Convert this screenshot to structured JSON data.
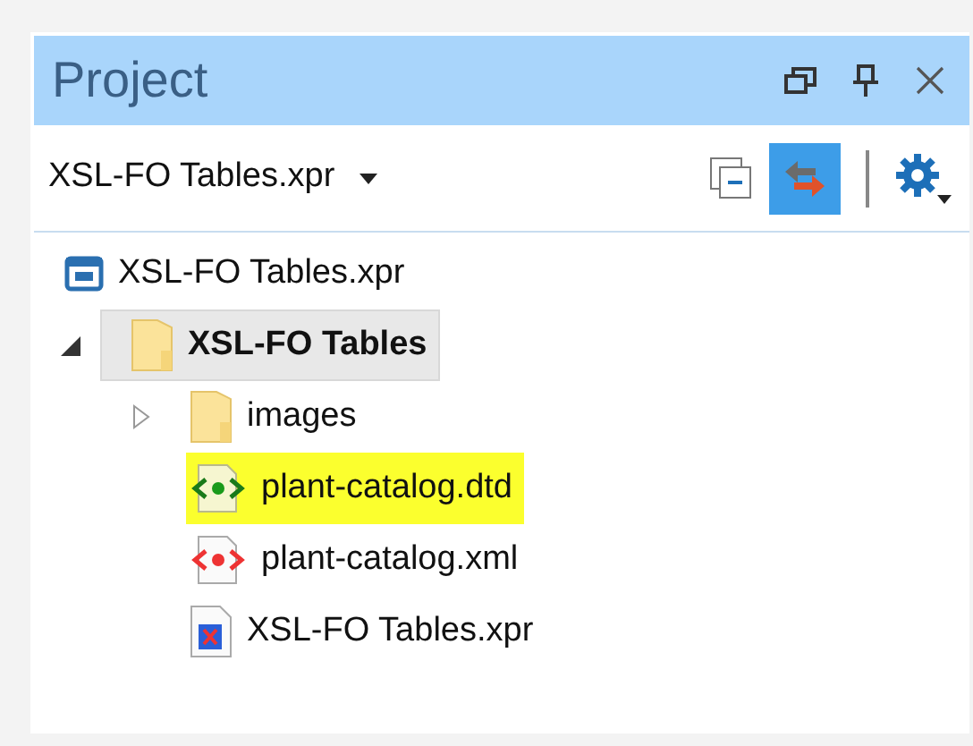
{
  "panel": {
    "title": "Project"
  },
  "toolbar": {
    "project_selector": "XSL-FO Tables.xpr",
    "link_with_editor": {
      "on": true
    }
  },
  "tree": [
    {
      "label": "XSL-FO Tables.xpr",
      "kind": "project",
      "selected": false
    },
    {
      "label": "XSL-FO Tables",
      "kind": "folder",
      "selected": true,
      "expanded": true,
      "children": [
        {
          "label": "images",
          "kind": "folder",
          "selected": false,
          "expanded": false
        },
        {
          "label": "plant-catalog.dtd",
          "kind": "dtd",
          "selected": false,
          "highlighted": true
        },
        {
          "label": "plant-catalog.xml",
          "kind": "xml",
          "selected": false,
          "highlighted": false
        },
        {
          "label": "XSL-FO Tables.xpr",
          "kind": "xpr",
          "selected": false,
          "highlighted": false
        }
      ]
    }
  ]
}
